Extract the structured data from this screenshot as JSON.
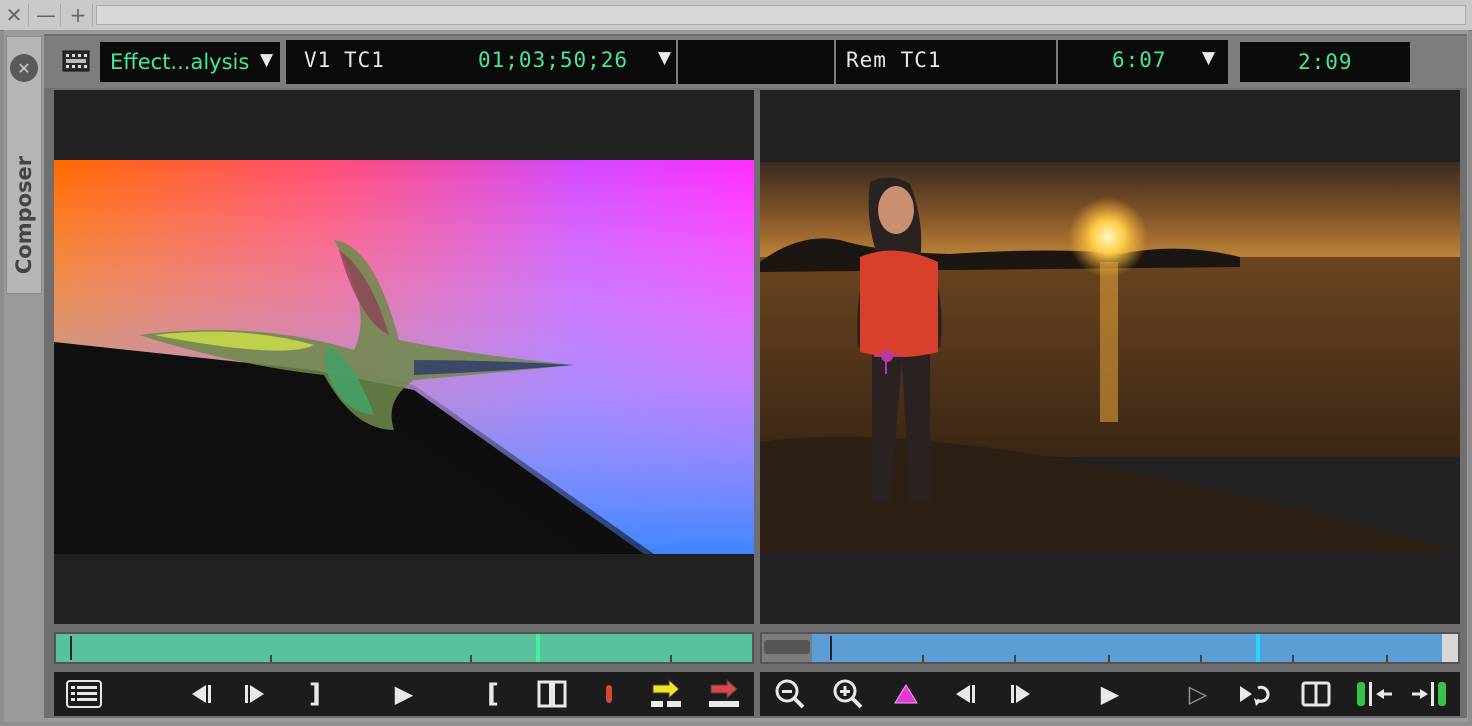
{
  "titlebar": {
    "close_glyph": "✕",
    "minimize_glyph": "—",
    "maximize_glyph": "+"
  },
  "sidetab": {
    "label": "Composer",
    "close_glyph": "✕"
  },
  "header": {
    "effect_select": {
      "value": "Effect...alysis"
    },
    "source_track": "V1",
    "source_tc_label": "TC1",
    "source_timecode": "01;03;50;26",
    "record_tc_label": "Rem  TC1",
    "record_duration": "6:07",
    "record_position": "2:09"
  },
  "colors": {
    "scrub_left": "#57c1a0",
    "scrub_right": "#5b9dd5",
    "scrub_left_marker": "#46f0a0",
    "scrub_right_marker": "#22d8ff",
    "timecode_green": "#46e89a",
    "mark_in_yellow": "#f3e51f",
    "mark_out_red": "#e04545",
    "sticks_green": "#39c24a",
    "add_keyframe_magenta": "#e23ad8"
  },
  "source_scrub": {
    "position": 0.69
  },
  "record_scrub": {
    "position": 0.71
  },
  "source_controls": [
    {
      "name": "clip-list-icon"
    },
    {
      "name": "step-back-icon"
    },
    {
      "name": "step-forward-icon"
    },
    {
      "name": "mark-out-bracket-icon",
      "glyph": "]"
    },
    {
      "name": "play-icon",
      "glyph": "▶"
    },
    {
      "name": "mark-in-bracket-icon",
      "glyph": "["
    },
    {
      "name": "clear-marks-icon"
    },
    {
      "name": "mark-clip-icon"
    },
    {
      "name": "splice-in-icon"
    },
    {
      "name": "overwrite-icon"
    }
  ],
  "record_controls": [
    {
      "name": "zoom-out-icon"
    },
    {
      "name": "zoom-in-icon"
    },
    {
      "name": "add-keyframe-icon"
    },
    {
      "name": "step-back-icon"
    },
    {
      "name": "step-forward-icon"
    },
    {
      "name": "play-icon",
      "glyph": "▶"
    },
    {
      "name": "play-preview-icon",
      "glyph": "▷"
    },
    {
      "name": "play-loop-icon"
    },
    {
      "name": "split-view-icon"
    },
    {
      "name": "trim-left-icon"
    },
    {
      "name": "trim-right-icon"
    }
  ]
}
